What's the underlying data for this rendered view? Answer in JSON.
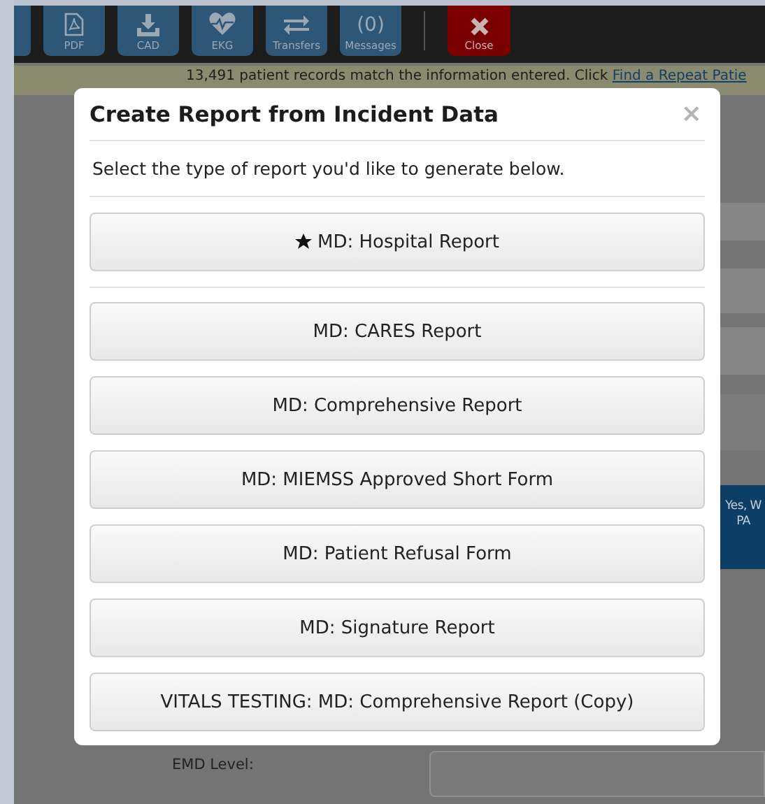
{
  "toolbar": {
    "buttons": [
      {
        "label": "PDF",
        "kind": "pdf"
      },
      {
        "label": "CAD",
        "kind": "download"
      },
      {
        "label": "EKG",
        "kind": "heart"
      },
      {
        "label": "Transfers",
        "kind": "transfer"
      },
      {
        "label": "Messages",
        "count": "(0)",
        "kind": "messages"
      },
      {
        "label": "Close",
        "kind": "close"
      }
    ]
  },
  "banner": {
    "text": "13,491 patient records match the information entered. Click",
    "link": "Find a Repeat Patie"
  },
  "background": {
    "side_button": {
      "lines": [
        "Yes, W",
        "PA"
      ]
    },
    "fields": [
      {
        "label": "EMD Level:"
      }
    ]
  },
  "modal": {
    "title": "Create Report from Incident Data",
    "close": "×",
    "subtitle": "Select the type of report you'd like to generate below.",
    "featured_reports": [
      {
        "label": "MD: Hospital Report",
        "starred": true
      }
    ],
    "reports": [
      {
        "label": "MD: CARES Report",
        "starred": false
      },
      {
        "label": "MD: Comprehensive Report",
        "starred": false
      },
      {
        "label": "MD: MIEMSS Approved Short Form",
        "starred": false
      },
      {
        "label": "MD: Patient Refusal Form",
        "starred": false
      },
      {
        "label": "MD: Signature Report",
        "starred": false
      },
      {
        "label": "VITALS TESTING: MD: Comprehensive Report (Copy)",
        "starred": false
      }
    ]
  }
}
